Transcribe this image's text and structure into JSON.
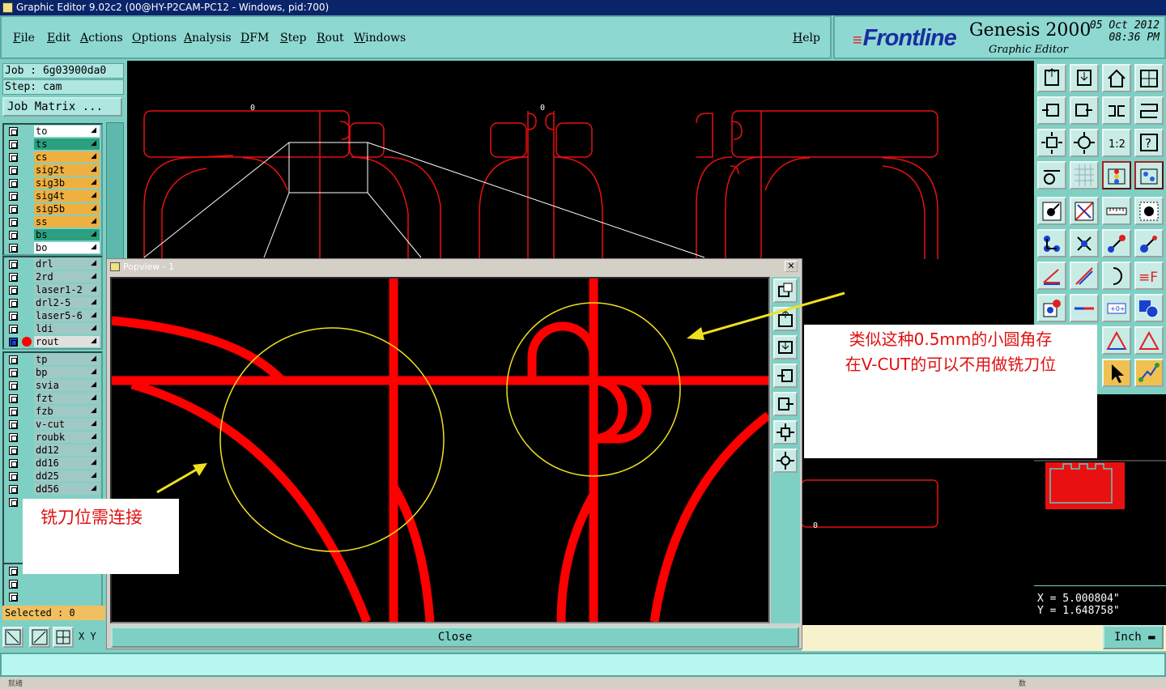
{
  "window": {
    "title": "Graphic Editor 9.02c2 (00@HY-P2CAM-PC12 - Windows, pid:700)"
  },
  "menu": {
    "items": [
      "File",
      "Edit",
      "Actions",
      "Options",
      "Analysis",
      "DFM",
      "Step",
      "Rout",
      "Windows"
    ],
    "help": "Help"
  },
  "brand": {
    "logo": "Frontline",
    "product": "Genesis 2000",
    "subtitle": "Graphic Editor",
    "date": "05 Oct 2012",
    "time": "08:36 PM"
  },
  "job": {
    "job_label": "Job : 6g03900da0",
    "step_label": "Step: cam",
    "matrix_button": "Job Matrix ..."
  },
  "layers": {
    "group1": [
      {
        "name": "to",
        "color": "#ffffff"
      },
      {
        "name": "ts",
        "color": "#2aa080"
      },
      {
        "name": "cs",
        "color": "#f0b040"
      },
      {
        "name": "sig2t",
        "color": "#f0b040"
      },
      {
        "name": "sig3b",
        "color": "#f0b040"
      },
      {
        "name": "sig4t",
        "color": "#f0b040"
      },
      {
        "name": "sig5b",
        "color": "#f0b040"
      },
      {
        "name": "ss",
        "color": "#f0b040"
      },
      {
        "name": "bs",
        "color": "#2aa080"
      },
      {
        "name": "bo",
        "color": "#ffffff"
      }
    ],
    "group2": [
      {
        "name": "drl",
        "color": "#a0c8c4"
      },
      {
        "name": "2rd",
        "color": "#a0c8c4"
      },
      {
        "name": "laser1-2",
        "color": "#a0c8c4"
      },
      {
        "name": "drl2-5",
        "color": "#a0c8c4"
      },
      {
        "name": "laser5-6",
        "color": "#a0c8c4"
      },
      {
        "name": "ldi",
        "color": "#a0c8c4"
      },
      {
        "name": "rout",
        "color": "#e0e0e0"
      }
    ],
    "group3": [
      {
        "name": "tp",
        "color": "#a0c8c4"
      },
      {
        "name": "bp",
        "color": "#a0c8c4"
      },
      {
        "name": "svia",
        "color": "#a0c8c4"
      },
      {
        "name": "fzt",
        "color": "#a0c8c4"
      },
      {
        "name": "fzb",
        "color": "#a0c8c4"
      },
      {
        "name": "v-cut",
        "color": "#a0c8c4"
      },
      {
        "name": "roubk",
        "color": "#a0c8c4"
      },
      {
        "name": "dd12",
        "color": "#a0c8c4"
      },
      {
        "name": "dd16",
        "color": "#a0c8c4"
      },
      {
        "name": "dd25",
        "color": "#a0c8c4"
      },
      {
        "name": "dd56",
        "color": "#a0c8c4"
      }
    ]
  },
  "status": {
    "selected": "Selected : 0",
    "xy": "X Y",
    "units": "Inch"
  },
  "coords": {
    "x": "X = 5.000804\"",
    "y": "Y = 1.648758\""
  },
  "canvas": {
    "zero_labels": [
      "0",
      "0",
      "0"
    ]
  },
  "popview": {
    "title": "Popview - 1",
    "close_label": "Close",
    "x_label": "✕"
  },
  "notes": {
    "note1_line1": "类似这种0.5mm的小圆角存",
    "note1_line2": "在V-CUT的可以不用做铣刀位",
    "note2": "铣刀位需连接"
  },
  "bottom": {
    "left": "就绪",
    "right": "数"
  }
}
